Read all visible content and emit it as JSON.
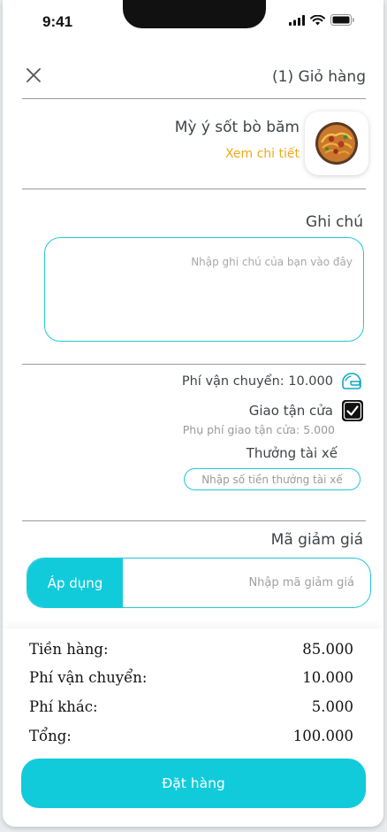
{
  "status_bar": {
    "time": "9:41"
  },
  "header": {
    "cart_title": "(1) Giỏ hàng"
  },
  "product": {
    "name": "Mỳ ý sốt bò băm",
    "detail_link": "Xem chi tiết"
  },
  "note": {
    "label": "Ghi chú",
    "placeholder": "Nhập ghi chú của bạn vào đây"
  },
  "shipping": {
    "fee_text": "Phí vận chuyển: 10.000",
    "door_delivery_label": "Giao tận cửa",
    "door_delivery_checked": true,
    "door_surcharge_text": "Phụ phí giao tận cửa: 5.000"
  },
  "tip": {
    "label": "Thưởng tài xế",
    "placeholder": "Nhập số tiền thưởng tài xế"
  },
  "coupon": {
    "label": "Mã giảm giá",
    "apply_label": "Áp dụng",
    "placeholder": "Nhập mã giảm giá"
  },
  "summary": {
    "rows": [
      {
        "label": "Tiền hàng:",
        "value": "85.000"
      },
      {
        "label": "Phí vận chuyển:",
        "value": "10.000"
      },
      {
        "label": "Phí khác:",
        "value": "5.000"
      },
      {
        "label": "Tổng:",
        "value": "100.000"
      }
    ]
  },
  "order_button": {
    "label": "Đặt hàng"
  },
  "colors": {
    "accent": "#11cbdb",
    "link": "#f0a81a",
    "text": "#3f4449"
  }
}
